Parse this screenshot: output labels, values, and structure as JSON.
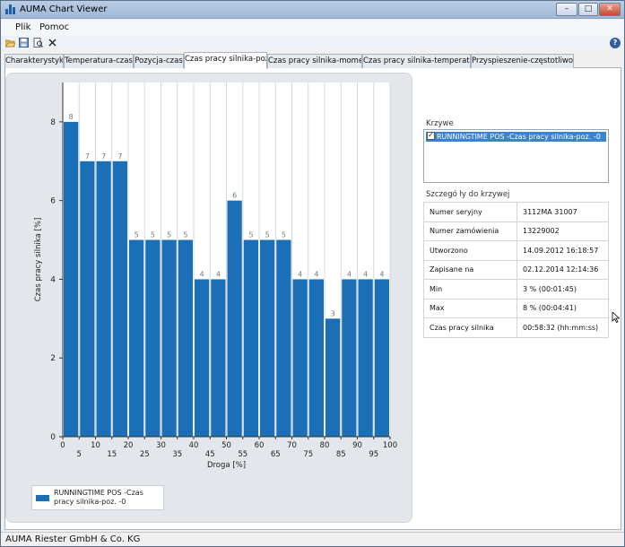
{
  "window": {
    "title": "AUMA Chart Viewer",
    "minimize": "–",
    "maximize": "□",
    "close": "✕"
  },
  "menu": {
    "items": [
      "Plik",
      "Pomoc"
    ]
  },
  "toolbar": {
    "icons": [
      "open-folder-icon",
      "save-icon",
      "print-preview-icon",
      "close-icon"
    ],
    "help": "?"
  },
  "tabs": [
    "Charakterystyki",
    "Temperatura-czas",
    "Pozycja-czas",
    "Czas pracy silnika-poz.",
    "Czas pracy silnika-moment",
    "Czas pracy silnika-temperatura",
    "Przyspieszenie-częstotliwość"
  ],
  "active_tab": 3,
  "chart_data": {
    "type": "bar",
    "xlabel": "Droga [%]",
    "ylabel": "Czas pracy silnika [%]",
    "x": [
      0,
      5,
      10,
      15,
      20,
      25,
      30,
      35,
      40,
      45,
      50,
      55,
      60,
      65,
      70,
      75,
      80,
      85,
      90,
      95,
      100
    ],
    "x_tick_labels": [
      "0",
      "5",
      "10",
      "15",
      "20",
      "25",
      "30",
      "35",
      "40",
      "45",
      "50",
      "55",
      "60",
      "65",
      "70",
      "75",
      "80",
      "85",
      "90",
      "95",
      "100"
    ],
    "y_ticks": [
      "0",
      "2",
      "4",
      "6",
      "8"
    ],
    "ylim": [
      0,
      9
    ],
    "series": [
      {
        "name": "RUNNINGTIME POS    -Czas pracy silnika-poz. -0",
        "values": [
          8,
          7,
          7,
          7,
          5,
          5,
          5,
          5,
          4,
          4,
          6,
          5,
          5,
          5,
          4,
          4,
          3,
          4,
          4,
          4
        ],
        "color": "#1a6fb7"
      }
    ],
    "data_labels": true,
    "grid": "vertical",
    "legend_position": "bottom-left"
  },
  "legend": {
    "label": "RUNNINGTIME POS    -Czas pracy silnika-poz. -0"
  },
  "curves": {
    "title": "Krzywe",
    "items": [
      {
        "label": "RUNNINGTIME POS    -Czas pracy silnika-poz. -0",
        "checked": true
      }
    ]
  },
  "details": {
    "title": "Szczegó ły do krzywej",
    "rows": [
      {
        "key": "Numer seryjny",
        "value": "3112MA 31007"
      },
      {
        "key": "Numer zamówienia",
        "value": "13229002"
      },
      {
        "key": "Utworzono",
        "value": "14.09.2012 16:18:57"
      },
      {
        "key": "Zapisane na",
        "value": "02.12.2014 12:14:36"
      },
      {
        "key": "Min",
        "value": "3 %   (00:01:45)"
      },
      {
        "key": "Max",
        "value": "8 %   (00:04:41)"
      },
      {
        "key": "Czas pracy silnika",
        "value": "00:58:32 (hh:mm:ss)"
      }
    ]
  },
  "status": {
    "text": "AUMA Riester GmbH & Co. KG"
  }
}
